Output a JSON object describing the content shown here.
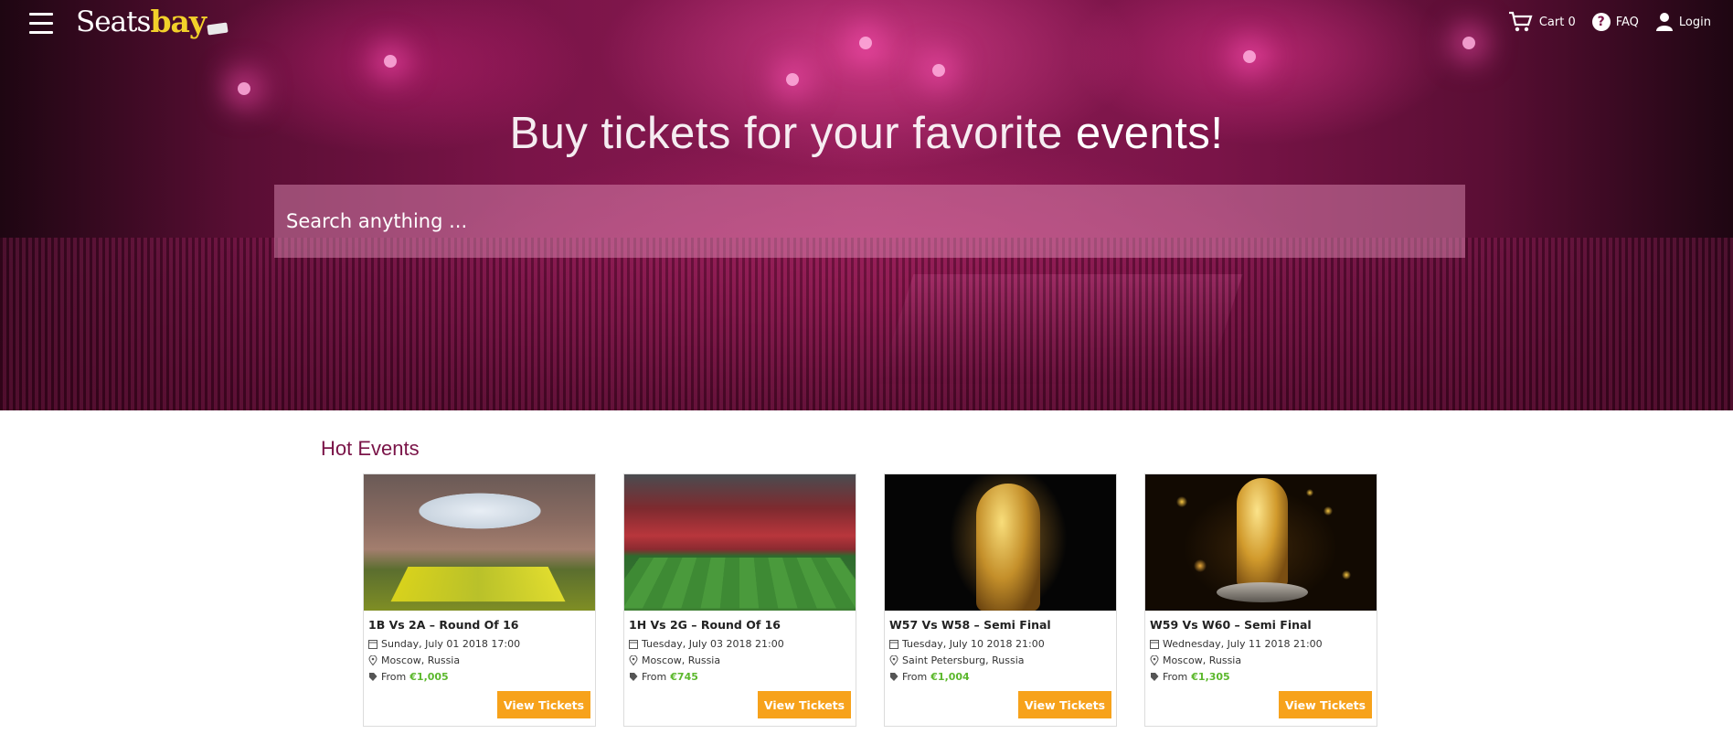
{
  "nav": {
    "logo_part1": "Seats",
    "logo_part2": "bay",
    "cart_label": "Cart 0",
    "faq_label": "FAQ",
    "login_label": "Login"
  },
  "hero": {
    "title_light": "Buy tickets for your favorite ",
    "title_bold": "events!",
    "search_placeholder": "Search anything ..."
  },
  "hot_events": {
    "heading": "Hot Events",
    "view_label": "View Tickets",
    "from_label": "From",
    "events": [
      {
        "title": "1B Vs 2A – Round Of 16",
        "date": "Sunday, July 01 2018 17:00",
        "location": "Moscow, Russia",
        "price": "€1,005"
      },
      {
        "title": "1H Vs 2G – Round Of 16",
        "date": "Tuesday, July 03 2018 21:00",
        "location": "Moscow, Russia",
        "price": "€745"
      },
      {
        "title": "W57 Vs W58 – Semi Final",
        "date": "Tuesday, July 10 2018 21:00",
        "location": "Saint Petersburg, Russia",
        "price": "€1,004"
      },
      {
        "title": "W59 Vs W60 – Semi Final",
        "date": "Wednesday, July 11 2018 21:00",
        "location": "Moscow, Russia",
        "price": "€1,305"
      }
    ]
  },
  "colors": {
    "accent_button": "#f7a21b",
    "heading_color": "#7a1448",
    "price_color": "#5cb82d",
    "logo_yellow": "#f2d02a"
  }
}
